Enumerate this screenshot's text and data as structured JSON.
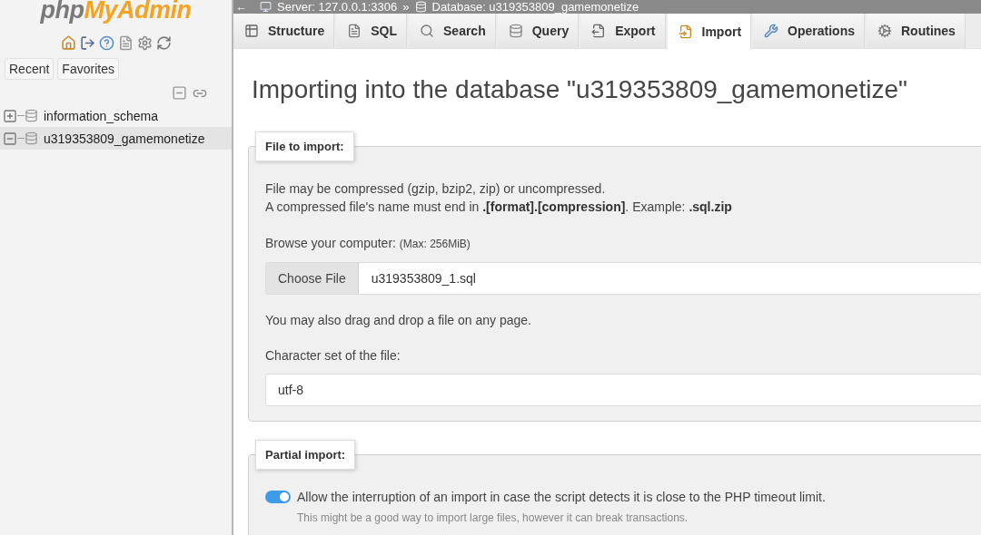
{
  "sidebar": {
    "logo": {
      "prefix": "php",
      "suffix": "MyAdmin"
    },
    "buttons": [
      {
        "label": "Recent"
      },
      {
        "label": "Favorites"
      }
    ],
    "tree": [
      {
        "label": "information_schema",
        "expanded": false,
        "selected": false
      },
      {
        "label": "u319353809_gamemonetize",
        "expanded": true,
        "selected": true
      }
    ]
  },
  "breadcrumb": {
    "back": "←",
    "server": "Server: 127.0.0.1:3306",
    "separator": "»",
    "database": "Database: u319353809_gamemonetize"
  },
  "tabs": [
    {
      "label": "Structure",
      "selected": false
    },
    {
      "label": "SQL",
      "selected": false
    },
    {
      "label": "Search",
      "selected": false
    },
    {
      "label": "Query",
      "selected": false
    },
    {
      "label": "Export",
      "selected": false
    },
    {
      "label": "Import",
      "selected": true
    },
    {
      "label": "Operations",
      "selected": false
    },
    {
      "label": "Routines",
      "selected": false
    }
  ],
  "heading": "Importing into the database \"u319353809_gamemonetize\"",
  "file_to_import": {
    "legend": "File to import:",
    "notes": [
      "File may be compressed (gzip, bzip2, zip) or uncompressed.",
      "A compressed file's name must end in **.[format].[compression]**. Example: **.sql.zip**"
    ],
    "browse_label": "Browse your computer:",
    "max_size": "(Max: 256MiB)",
    "choose_button": "Choose File",
    "file_name": "u319353809_1.sql",
    "drag_note": "You may also drag and drop a file on any page.",
    "charset_label": "Character set of the file:",
    "charset_value": "utf-8"
  },
  "partial_import": {
    "legend": "Partial import:",
    "allow_interruption": {
      "on": true,
      "label": "Allow the interruption of an import in case the script detects it is close to the PHP timeout limit.",
      "hint": "This might be a good way to import large files, however it can break transactions."
    }
  }
}
